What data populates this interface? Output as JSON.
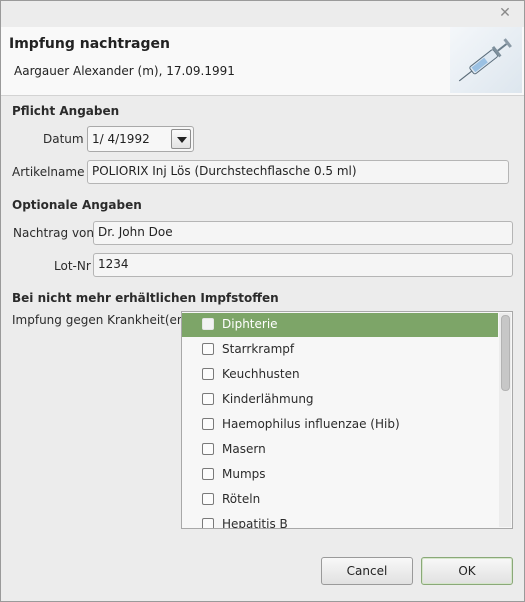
{
  "dialog": {
    "header_title": "Impfung nachtragen",
    "header_subtitle": "Aargauer Alexander (m), 17.09.1991"
  },
  "sections": {
    "required": "Pflicht Angaben",
    "optional": "Optionale Angaben",
    "unavailable": "Bei nicht mehr erhältlichen Impfstoffen"
  },
  "fields": {
    "datum_label": "Datum",
    "datum_value": "1/ 4/1992",
    "artikel_label": "Artikelname",
    "artikel_value": "POLIORIX Inj Lös (Durchstechflasche 0.5 ml)",
    "nachtrag_label": "Nachtrag von",
    "nachtrag_value": "Dr. John Doe",
    "lot_label": "Lot-Nr",
    "lot_value": "1234",
    "krankheit_label": "Impfung gegen Krankheit(en)"
  },
  "diseases": [
    {
      "label": "Diphterie",
      "checked": false,
      "selected": true
    },
    {
      "label": "Starrkrampf",
      "checked": false,
      "selected": false
    },
    {
      "label": "Keuchhusten",
      "checked": false,
      "selected": false
    },
    {
      "label": "Kinderlähmung",
      "checked": false,
      "selected": false
    },
    {
      "label": "Haemophilus influenzae (Hib)",
      "checked": false,
      "selected": false
    },
    {
      "label": "Masern",
      "checked": false,
      "selected": false
    },
    {
      "label": "Mumps",
      "checked": false,
      "selected": false
    },
    {
      "label": "Röteln",
      "checked": false,
      "selected": false
    },
    {
      "label": "Hepatitis B",
      "checked": false,
      "selected": false
    }
  ],
  "buttons": {
    "cancel": "Cancel",
    "ok": "OK"
  },
  "colors": {
    "selected_row": "#7da568",
    "window_bg": "#ececec"
  },
  "icons": {
    "close": "close-icon",
    "syringe": "syringe-icon",
    "dropdown": "chevron-down-icon"
  }
}
